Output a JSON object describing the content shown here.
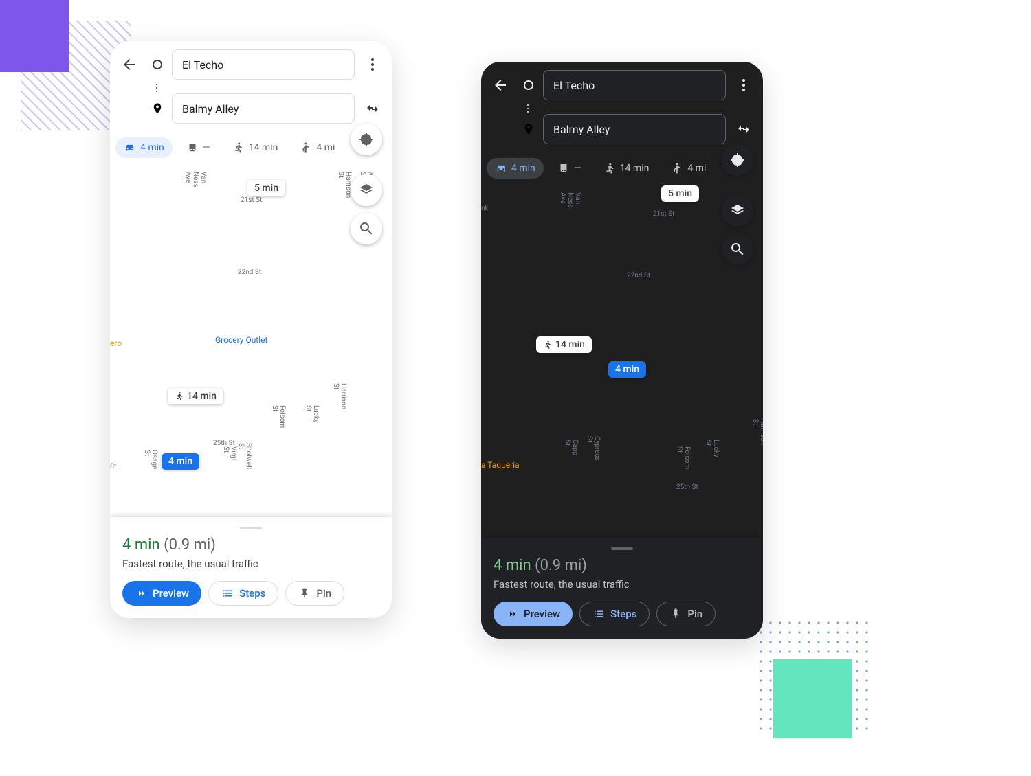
{
  "origin": "El Techo",
  "destination": "Balmy Alley",
  "modes": {
    "drive": "4 min",
    "transit": "—",
    "walk": "14 min",
    "rideshare": "4 mi"
  },
  "map": {
    "alt_route_label": "5 min",
    "walk_route_label": "14 min",
    "selected_route_label": "4 min",
    "poi_grocery": "Grocery Outlet",
    "poi_taqueria": "a Taqueria",
    "poi_ero": "ero",
    "streets": {
      "van_ness": "Van Ness Ave",
      "folsom": "Folsom St",
      "harrison": "Harrison St",
      "alabama": "Alabama St",
      "capp": "Capp St",
      "cypress": "Cypress St",
      "lucky": "Lucky St",
      "virgil": "Virgil St",
      "osage": "Osage St",
      "shotwell": "Shotwell St",
      "st_21": "21st St",
      "st_22": "22nd St",
      "st_25": "25th St",
      "st_end": "St",
      "nk": "nk"
    }
  },
  "sheet": {
    "time": "4 min",
    "distance": "(0.9 mi)",
    "subtitle": "Fastest route, the usual traffic",
    "preview": "Preview",
    "steps": "Steps",
    "pin": "Pin"
  },
  "colors": {
    "drive_route": "#1a73e8",
    "traffic_orange": "#fbbc04",
    "alt_route": "#9aa0a6",
    "green_time": "#188038",
    "dest_pin": "#ea4335"
  }
}
